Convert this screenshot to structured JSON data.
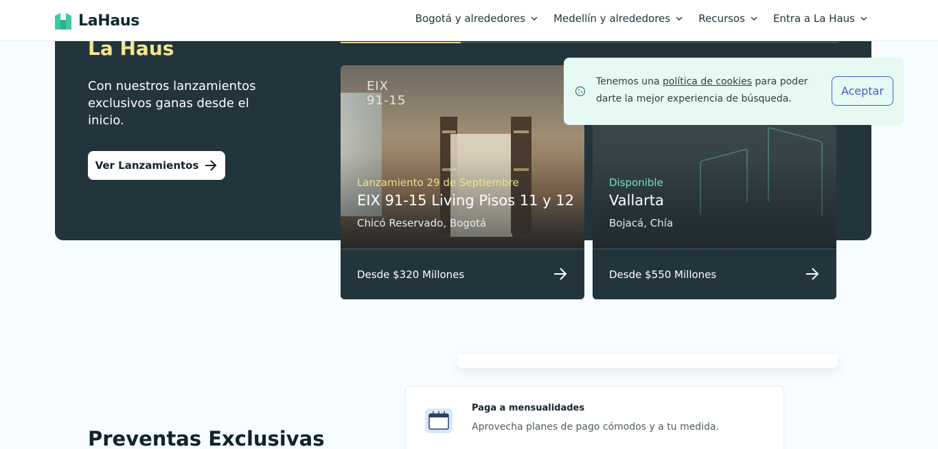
{
  "header": {
    "brand": "LaHaus",
    "nav": [
      {
        "label": "Bogotá y alrededores"
      },
      {
        "label": "Medellín y alrededores"
      },
      {
        "label": "Recursos"
      },
      {
        "label": "Entra a La Haus"
      }
    ]
  },
  "hero": {
    "title": "La Haus",
    "subtitle": "Con nuestros lanzamientos exclusivos ganas desde el inicio.",
    "cta_label": "Ver Lanzamientos"
  },
  "cards": [
    {
      "status": "Lanzamiento 29 de Septiembre",
      "name": "EIX 91-15 Living Pisos 11 y 12",
      "location": "Chicó Reservado, Bogotá",
      "price": "Desde $320 Millones",
      "logo_text": "EIX",
      "logo_sub": "91-15"
    },
    {
      "status": "Disponible",
      "name": "Vallarta",
      "location": "Bojacá, Chía",
      "price": "Desde $550 Millones"
    }
  ],
  "cookie": {
    "text_before": "Tenemos una ",
    "link": "política de cookies",
    "text_after": " para poder darte la mejor experiencia de búsqueda.",
    "accept_label": "Aceptar"
  },
  "section": {
    "title": "Preventas Exclusivas"
  },
  "feature": {
    "title": "Paga a mensualidades",
    "description": "Aprovecha planes de pago cómodos y a tu medida."
  },
  "colors": {
    "brand_green": "#3DC9A1",
    "dark_bg": "#22353D",
    "accent_yellow": "#F7E68C",
    "link_blue": "#3E5BD6"
  }
}
